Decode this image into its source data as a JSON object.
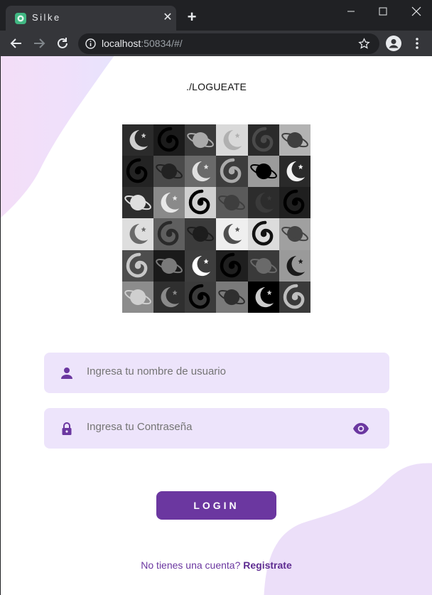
{
  "browser": {
    "tab_title": "Silke",
    "tab_close": "✕",
    "new_tab": "+",
    "url_host": "localhost",
    "url_rest": ":50834/#/"
  },
  "page": {
    "title": "./LOGUEATE",
    "username_placeholder": "Ingresa tu nombre de usuario",
    "password_placeholder": "Ingresa tu Contraseña",
    "login_label": "LOGIN",
    "signup_prompt": "No tienes una cuenta?",
    "signup_link": "Registrate"
  },
  "colors": {
    "accent": "#6b37a0",
    "field_bg": "#ede4fb"
  },
  "logo_grid": [
    [
      "moon",
      "spiral",
      "planet",
      "moon",
      "spiral",
      "planet"
    ],
    [
      "spiral",
      "planet",
      "moon",
      "spiral",
      "planet",
      "moon"
    ],
    [
      "planet",
      "moon",
      "spiral",
      "planet",
      "moon",
      "spiral"
    ],
    [
      "moon",
      "spiral",
      "planet",
      "moon",
      "spiral",
      "planet"
    ],
    [
      "spiral",
      "planet",
      "moon",
      "spiral",
      "planet",
      "moon"
    ],
    [
      "planet",
      "moon",
      "spiral",
      "planet",
      "moon",
      "spiral"
    ]
  ]
}
